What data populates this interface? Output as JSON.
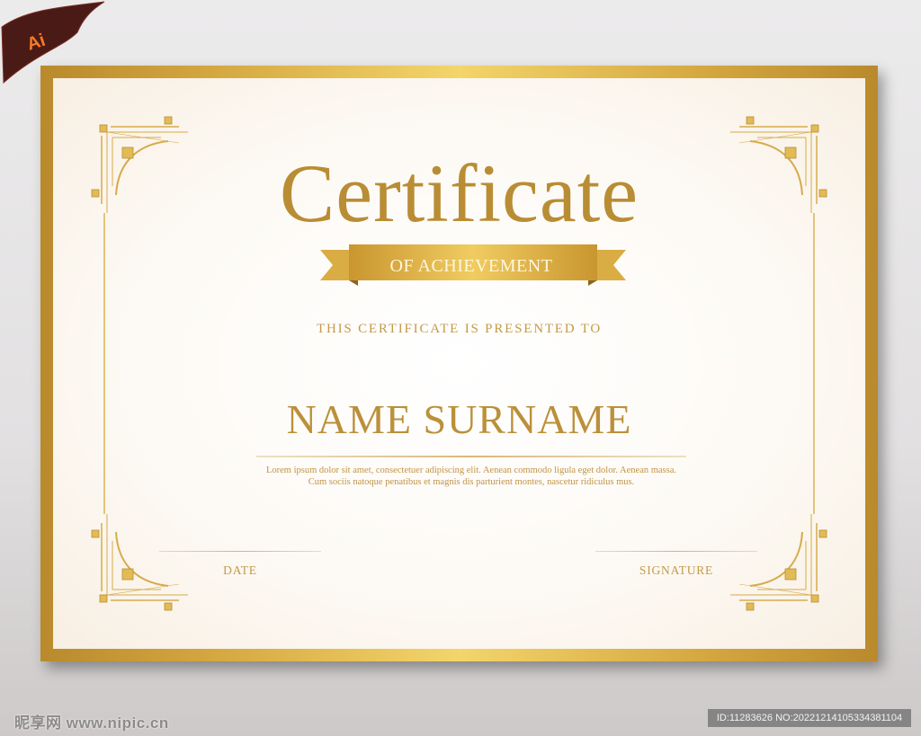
{
  "badge": {
    "label": "Ai",
    "icon": "illustrator-ribbon-icon",
    "color": "#f57a2b"
  },
  "certificate": {
    "title": "Certificate",
    "subtitle": "OF ACHIEVEMENT",
    "presented_to": "THIS CERTIFICATE IS PRESENTED TO",
    "recipient_name": "NAME SURNAME",
    "body_text": "Lorem ipsum dolor sit amet, consectetuer adipiscing elit. Aenean commodo ligula eget dolor. Aenean massa. Cum sociis natoque penatibus et magnis dis parturient montes, nascetur ridiculus mus.",
    "date_label": "DATE",
    "signature_label": "SIGNATURE",
    "colors": {
      "gold": "#b98d34",
      "gold_light": "#f3d56a",
      "paper": "#fdfaf5"
    }
  },
  "watermark": {
    "site": "昵享网 www.nipic.cn",
    "id_text": "ID:11283626 NO:20221214105334381104"
  }
}
